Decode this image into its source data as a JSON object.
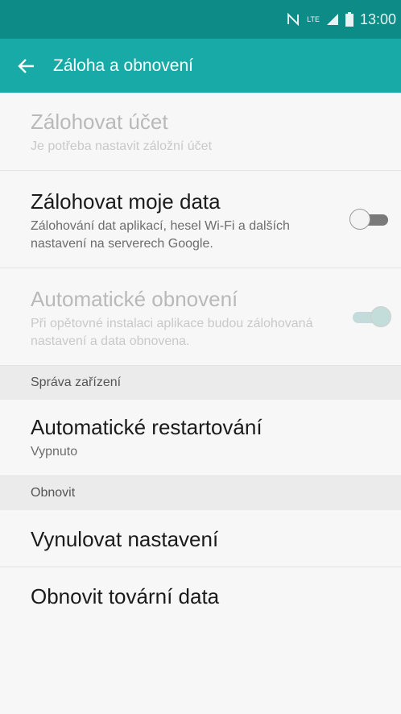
{
  "status_bar": {
    "time": "13:00",
    "network": "LTE"
  },
  "app_bar": {
    "title": "Záloha a obnovení"
  },
  "backup_account": {
    "title": "Zálohovat účet",
    "subtitle": "Je potřeba nastavit záložní účet"
  },
  "backup_data": {
    "title": "Zálohovat moje data",
    "subtitle": "Zálohování dat aplikací, hesel Wi-Fi a dalších nastavení na serverech Google.",
    "toggle_on": false
  },
  "auto_restore": {
    "title": "Automatické obnovení",
    "subtitle": "Při opětovné instalaci aplikace budou zálohovaná nastavení a data obnovena.",
    "toggle_on": true
  },
  "section_device": {
    "label": "Správa zařízení"
  },
  "auto_restart": {
    "title": "Automatické restartování",
    "subtitle": "Vypnuto"
  },
  "section_reset": {
    "label": "Obnovit"
  },
  "reset_settings": {
    "title": "Vynulovat nastavení"
  },
  "factory_reset": {
    "title": "Obnovit tovární data"
  },
  "colors": {
    "status_bar": "#0c8b87",
    "app_bar": "#18aaa6",
    "background": "#f7f7f7"
  }
}
